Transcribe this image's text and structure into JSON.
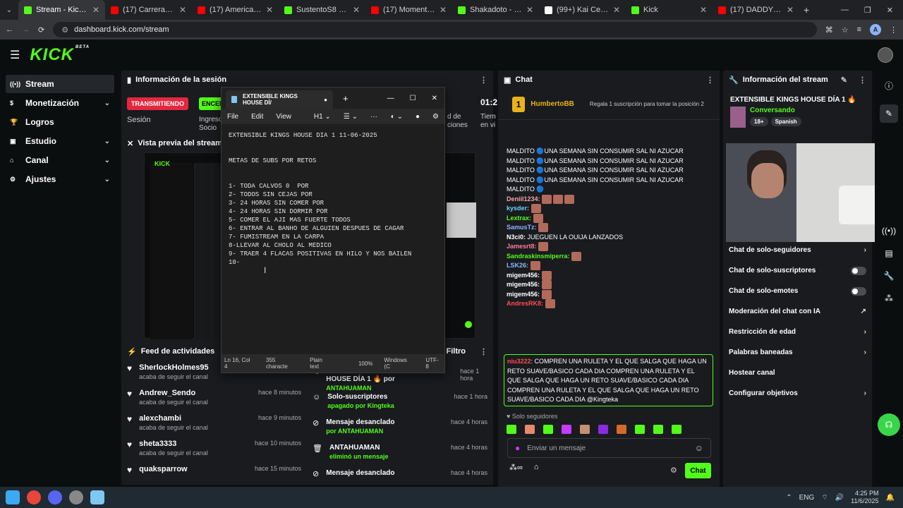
{
  "browser": {
    "tabs": [
      {
        "title": "Stream - Kick Dashboard",
        "color": "#53fc18",
        "active": true
      },
      {
        "title": "(17) Carrera de gordo",
        "color": "#ff0000"
      },
      {
        "title": "(17) American Pie 6 -",
        "color": "#ff0000"
      },
      {
        "title": "SustentoS8 - Watch",
        "color": "#53fc18"
      },
      {
        "title": "(17) Momento exacto",
        "color": "#ff0000"
      },
      {
        "title": "Shakadoto - Watch",
        "color": "#53fc18"
      },
      {
        "title": "(99+) Kai Cenat's Insa",
        "color": "#ffffff"
      },
      {
        "title": "Kick",
        "color": "#53fc18"
      },
      {
        "title": "(17) DADDY YANKEE",
        "color": "#ff0000"
      }
    ],
    "url": "dashboard.kick.com/stream",
    "profile_initial": "A"
  },
  "kick": {
    "logo": "KICK",
    "logo_sup": "BETA"
  },
  "sidebar": {
    "items": [
      {
        "label": "Stream",
        "icon": "stream-icon"
      },
      {
        "label": "Monetización",
        "icon": "dollar-icon"
      },
      {
        "label": "Logros",
        "icon": "trophy-icon"
      },
      {
        "label": "Estudio",
        "icon": "studio-icon"
      },
      {
        "label": "Canal",
        "icon": "channel-icon"
      },
      {
        "label": "Ajustes",
        "icon": "gear-icon"
      }
    ]
  },
  "session": {
    "title": "Información de la sesión",
    "live_badge": "TRANSMITIENDO",
    "encode_badge": "ENCEN",
    "label_session": "Sesión",
    "label_income": "Ingreso",
    "label_social": "Socio",
    "label_d": "d de",
    "label_ciones": "ciones",
    "timer": "01:2",
    "label_tiem": "Tiem",
    "label_envi": "en vi"
  },
  "preview": {
    "title": "Vista previa del stream"
  },
  "activity": {
    "title": "Feed de actividades",
    "filter": "Filtro",
    "left": [
      {
        "name": "SherlockHolmes95",
        "sub": "acaba de seguir el canal",
        "time": ""
      },
      {
        "name": "Andrew_Sendo",
        "sub": "acaba de seguir el canal",
        "time": "hace 8 minutos"
      },
      {
        "name": "alexchambi",
        "sub": "acaba de seguir el canal",
        "time": "hace 9 minutos"
      },
      {
        "name": "sheta3333",
        "sub": "acaba de seguir el canal",
        "time": "hace 10 minutos"
      },
      {
        "name": "quaksparrow",
        "sub": "",
        "time": "hace 15 minutos"
      }
    ],
    "right": [
      {
        "line1": "cambiado a EXTENSIBLE KINGS HOUSE DÍA 1 🔥 por",
        "line2": "ANTAHUAMAN",
        "time": "hace 1 hora"
      },
      {
        "line1": "Solo-suscriptores",
        "line2": "apagado por Kingteka",
        "time": "hace 1 hora"
      },
      {
        "line1": "Mensaje desanclado",
        "line2": "por ANTAHUAMAN",
        "time": "hace 4 horas"
      },
      {
        "line1": "ANTAHUAMAN",
        "line2": "eliminó un mensaje",
        "time": "hace 4 horas"
      },
      {
        "line1": "Mensaje desanclado",
        "line2": "",
        "time": "hace 4 horas"
      }
    ]
  },
  "notepad": {
    "tab_title": "EXTENSIBLE KINGS HOUSE DÍ/",
    "menu": [
      "File",
      "Edit",
      "View",
      "H1"
    ],
    "content": "EXTENSIBLE KINGS HOUSE DIA 1 11-06-2025\n\n\nMETAS DE SUBS POR RETOS\n\n\n1- TODA CALVOS 0  POR\n2- TODOS SIN CEJAS POR\n3- 24 HORAS SIN COMER POR\n4- 24 HORAS SIN DORMIR POR\n5- COMER EL AJI MAS FUERTE TODOS\n6- ENTRAR AL BANHO DE ALGUIEN DESPUES DE CAGAR\n7- FUMISTREAM EN LA CARPA\n8-LLEVAR AL CHOLO AL MEDICO\n9- TRAER 4 FLACAS POSITIVAS EN HILO Y NOS BAILEN\n10-",
    "status": [
      "Ln 16, Col 4",
      "355 characte",
      "Plain text",
      "100%",
      "Windows (C",
      "UTF-8"
    ]
  },
  "chat": {
    "title": "Chat",
    "top_user": "HumbertoBB",
    "top_rank": "1",
    "gift_text": "Regala 1 suscripción para tomar la posición 2",
    "messages": [
      {
        "user": "",
        "text": "MALDITO 🔵UNA SEMANA SIN CONSUMIR SAL NI AZUCAR",
        "color": "#ffffff"
      },
      {
        "user": "",
        "text": "MALDITO 🔵UNA SEMANA SIN CONSUMIR SAL NI AZUCAR",
        "color": "#ffffff"
      },
      {
        "user": "",
        "text": "MALDITO 🔵UNA SEMANA SIN CONSUMIR SAL NI AZUCAR",
        "color": "#ffffff"
      },
      {
        "user": "",
        "text": "MALDITO 🔵UNA SEMANA SIN CONSUMIR SAL NI AZUCAR",
        "color": "#ffffff"
      },
      {
        "user": "",
        "text": "MALDITO 🔵",
        "color": "#ffffff"
      },
      {
        "user": "Deniil1234:",
        "text": "",
        "color": "#f7a3a3",
        "emotes": 3
      },
      {
        "user": "kysder:",
        "text": "",
        "color": "#6ad5ff",
        "emotes": 1
      },
      {
        "user": "Lextrax:",
        "text": "",
        "color": "#53fc18",
        "emotes": 1
      },
      {
        "user": "SamusTz:",
        "text": "",
        "color": "#8fb4ff",
        "emotes": 1
      },
      {
        "user": "N3ci0:",
        "text": "JUEGUEN LA OUIJA LANZADOS",
        "color": "#ffffff"
      },
      {
        "user": "Jamesrt8:",
        "text": "",
        "color": "#ff7a9c",
        "emotes": 1
      },
      {
        "user": "Sandraskinsmiperra:",
        "text": "",
        "color": "#53fc18",
        "emotes": 1
      },
      {
        "user": "LSK26:",
        "text": "",
        "color": "#8fb4ff",
        "emotes": 1
      },
      {
        "user": "migem456:",
        "text": "",
        "color": "#ffffff",
        "emotes": 1
      },
      {
        "user": "migem456:",
        "text": "",
        "color": "#ffffff",
        "emotes": 1
      },
      {
        "user": "migem456:",
        "text": "",
        "color": "#ffffff",
        "emotes": 1
      },
      {
        "user": "AndresRK8:",
        "text": "",
        "color": "#ff4d4d",
        "emotes": 1
      }
    ],
    "pinned_user": "niu3222",
    "pinned_text": "COMPREN UNA RULETA Y EL QUE SALGA QUE HAGA UN RETO SUAVE/BASICO CADA DIA COMPREN UNA RULETA Y EL QUE SALGA QUE HAGA UN RETO SUAVE/BASICO CADA DIA COMPREN UNA RULETA Y EL QUE SALGA QUE HAGA UN RETO SUAVE/BASICO CADA DIA @Kingteka",
    "followers_only": "Solo seguidores",
    "input_placeholder": "Enviar un mensaje",
    "send_label": "Chat"
  },
  "stream_info": {
    "title": "Información del stream",
    "stream_title": "EXTENSIBLE KINGS HOUSE DÍA 1 🔥",
    "category": "Conversando",
    "tags": [
      "18+",
      "Spanish"
    ],
    "settings": [
      {
        "label": "Chat de solo-seguidores",
        "ctrl": "chevron"
      },
      {
        "label": "Chat de solo-suscriptores",
        "ctrl": "toggle"
      },
      {
        "label": "Chat de solo-emotes",
        "ctrl": "toggle"
      },
      {
        "label": "Moderación del chat con IA",
        "ctrl": "link"
      },
      {
        "label": "Restricción de edad",
        "ctrl": "chevron"
      },
      {
        "label": "Palabras baneadas",
        "ctrl": "chevron"
      },
      {
        "label": "Hostear canal",
        "ctrl": "none"
      },
      {
        "label": "Configurar objetivos",
        "ctrl": "chevron"
      }
    ]
  },
  "taskbar": {
    "lang": "ENG",
    "time": "4:25 PM",
    "date": "11/6/2025"
  }
}
